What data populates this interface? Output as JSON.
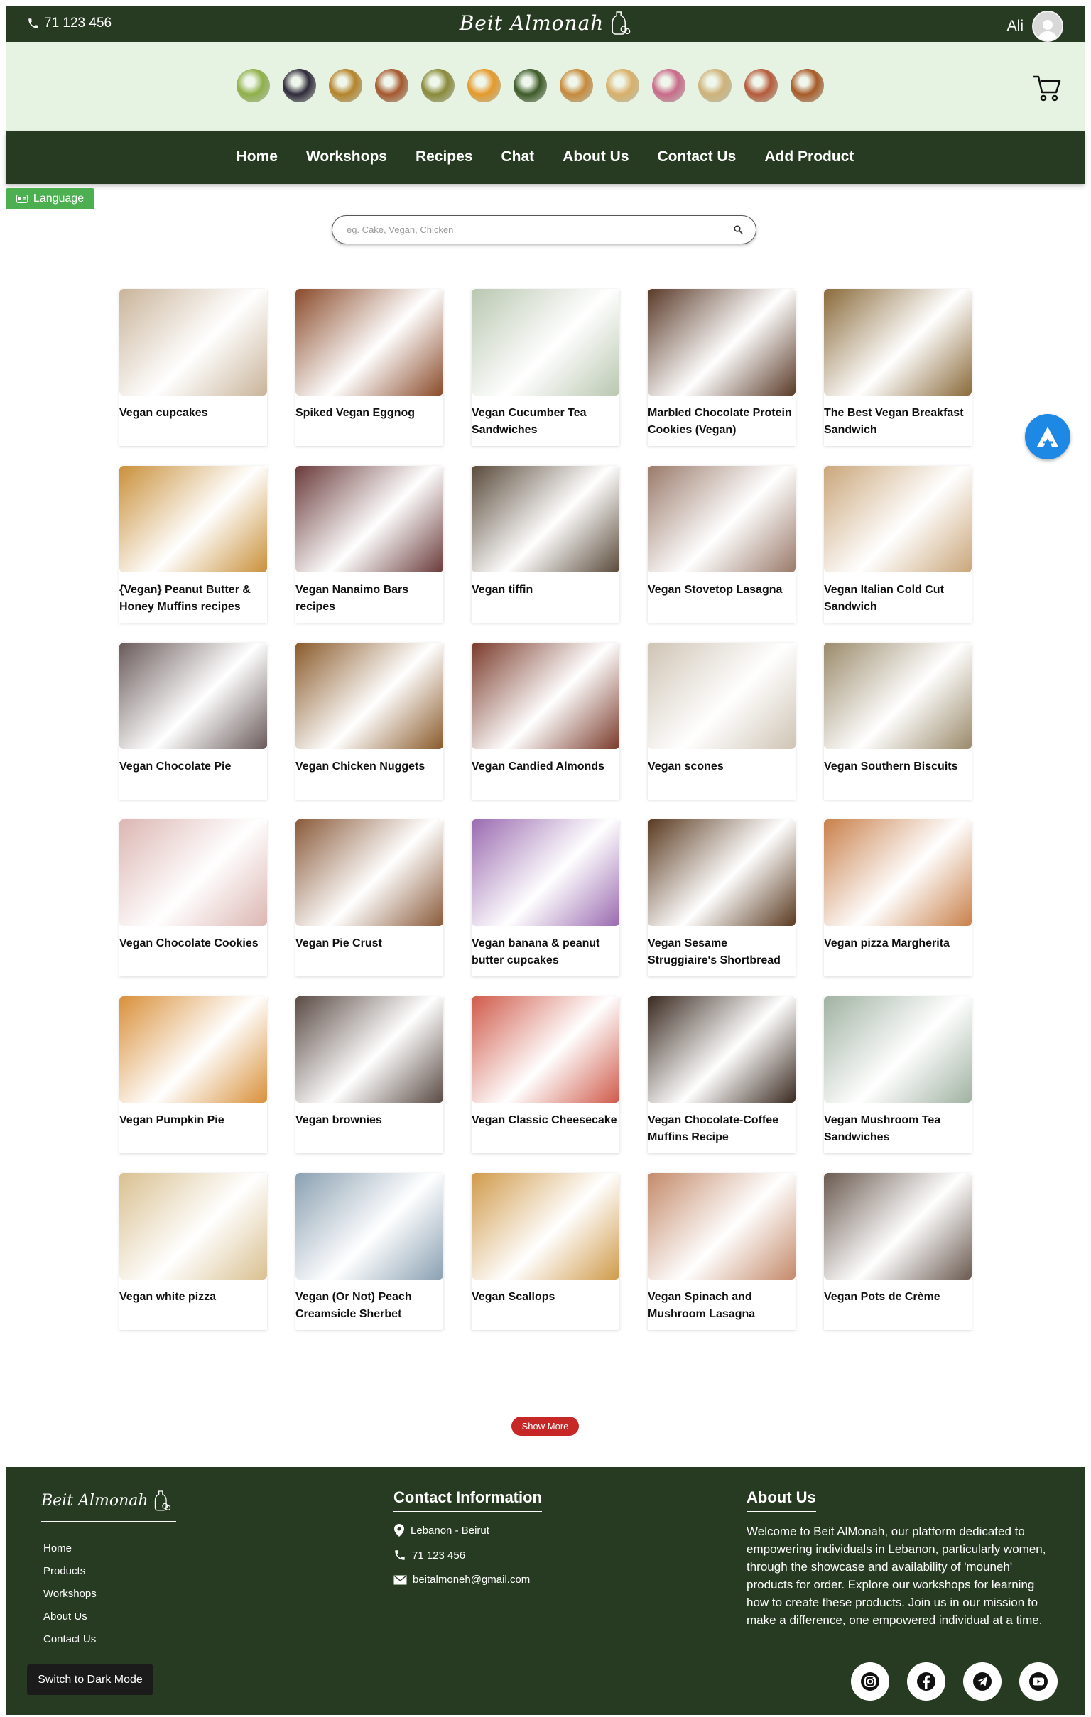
{
  "header": {
    "phone": "71 123 456",
    "logo": "Beit Almonah",
    "user_name": "Ali"
  },
  "categories": [
    {
      "icon": "grapes-icon",
      "color": "#8fb04a"
    },
    {
      "icon": "blackberries-icon",
      "color": "#2f2a3a"
    },
    {
      "icon": "soup-icon",
      "color": "#b5842c"
    },
    {
      "icon": "cinnamon-icon",
      "color": "#a5572d"
    },
    {
      "icon": "olive-oil-icon",
      "color": "#8a8a3a"
    },
    {
      "icon": "cheese-icon",
      "color": "#e5992a"
    },
    {
      "icon": "stuffed-leaves-icon",
      "color": "#3d5a28"
    },
    {
      "icon": "salad-plate-icon",
      "color": "#c78a3a"
    },
    {
      "icon": "dish-plate-icon",
      "color": "#d9b06a"
    },
    {
      "icon": "jam-jar-icon",
      "color": "#c96a8a"
    },
    {
      "icon": "bread-icon",
      "color": "#cfb27a"
    },
    {
      "icon": "jars-icon",
      "color": "#b65a3a"
    },
    {
      "icon": "falafel-icon",
      "color": "#a85a28"
    }
  ],
  "nav": [
    "Home",
    "Workshops",
    "Recipes",
    "Chat",
    "About Us",
    "Contact Us",
    "Add Product"
  ],
  "language_label": "Language",
  "search": {
    "placeholder": "eg. Cake, Vegan, Chicken"
  },
  "recipes": [
    {
      "name": "Vegan cupcakes",
      "color": "#c9b49a"
    },
    {
      "name": "Spiked Vegan Eggnog",
      "color": "#8a4a2a"
    },
    {
      "name": "Vegan Cucumber Tea Sandwiches",
      "color": "#b9c7b0"
    },
    {
      "name": "Marbled Chocolate Protein Cookies (Vegan)",
      "color": "#5a3a28"
    },
    {
      "name": "The Best Vegan Breakfast Sandwich",
      "color": "#8a6a3a"
    },
    {
      "name": "{Vegan} Peanut Butter & Honey Muffins recipes",
      "color": "#c9903a"
    },
    {
      "name": "Vegan Nanaimo Bars recipes",
      "color": "#6a3a3a"
    },
    {
      "name": "Vegan tiffin",
      "color": "#5a4a3a"
    },
    {
      "name": "Vegan Stovetop Lasagna",
      "color": "#9a7a6a"
    },
    {
      "name": "Vegan Italian Cold Cut Sandwich",
      "color": "#caa67a"
    },
    {
      "name": "Vegan Chocolate Pie",
      "color": "#6a5a5a"
    },
    {
      "name": "Vegan Chicken Nuggets",
      "color": "#8a5a2a"
    },
    {
      "name": "Vegan Candied Almonds",
      "color": "#7a3a2a"
    },
    {
      "name": "Vegan scones",
      "color": "#cfc4b4"
    },
    {
      "name": "Vegan Southern Biscuits",
      "color": "#9a8a6a"
    },
    {
      "name": "Vegan Chocolate Cookies",
      "color": "#dcb6b2"
    },
    {
      "name": "Vegan Pie Crust",
      "color": "#8a5a3a"
    },
    {
      "name": "Vegan banana & peanut butter cupcakes",
      "color": "#9a6ab0"
    },
    {
      "name": "Vegan Sesame Struggiaire's Shortbread",
      "color": "#5a3a20"
    },
    {
      "name": "Vegan pizza Margherita",
      "color": "#c9804a"
    },
    {
      "name": "Vegan Pumpkin Pie",
      "color": "#d9903a"
    },
    {
      "name": "Vegan brownies",
      "color": "#5a4a44"
    },
    {
      "name": "Vegan Classic Cheesecake",
      "color": "#d05a4a"
    },
    {
      "name": "Vegan Chocolate-Coffee Muffins Recipe",
      "color": "#3a2a20"
    },
    {
      "name": "Vegan Mushroom Tea Sandwiches",
      "color": "#a0b2a2"
    },
    {
      "name": "Vegan white pizza",
      "color": "#d9c090"
    },
    {
      "name": "Vegan (Or Not) Peach Creamsicle Sherbet",
      "color": "#8aa0b2"
    },
    {
      "name": "Vegan Scallops",
      "color": "#d09a4a"
    },
    {
      "name": "Vegan Spinach and Mushroom Lasagna",
      "color": "#c48a6a"
    },
    {
      "name": "Vegan Pots de Crème",
      "color": "#6a5a50"
    }
  ],
  "show_more": "Show More",
  "footer": {
    "logo": "Beit Almonah",
    "links": [
      "Home",
      "Products",
      "Workshops",
      "About Us",
      "Contact Us"
    ],
    "contact_title": "Contact Information",
    "location": "Lebanon - Beirut",
    "phone": "71 123 456",
    "email": "beitalmoneh@gmail.com",
    "about_title": "About Us",
    "about_text": "Welcome to Beit AlMonah, our platform dedicated to empowering individuals in Lebanon, particularly women, through the showcase and availability of 'mouneh' products for order. Explore our workshops for learning how to create these products. Join us in our mission to make a difference, one empowered individual at a time.",
    "dark_mode": "Switch to Dark Mode",
    "socials": [
      "instagram-icon",
      "facebook-icon",
      "telegram-icon",
      "youtube-icon"
    ]
  },
  "colors": {
    "primary": "#273b22",
    "band": "#e7f3e2",
    "accent_red": "#c62828",
    "language_green": "#4caf50",
    "support_blue": "#1e88e5"
  }
}
